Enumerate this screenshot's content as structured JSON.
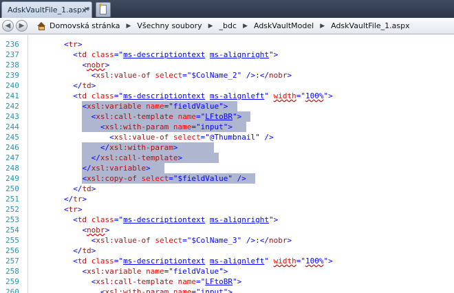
{
  "tabs": {
    "active_label": "AdskVaultFile_1.aspx",
    "modified_marker": "*",
    "close_glyph": "×"
  },
  "breadcrumb": {
    "back_icon": "back-arrow-icon",
    "forward_icon": "forward-arrow-icon",
    "items": [
      "Domovská stránka",
      "Všechny soubory",
      "_bdc",
      "AdskVaultModel",
      "AdskVaultFile_1.aspx"
    ]
  },
  "colors": {
    "selection": "#aeb7cf",
    "line_number": "#2b91af",
    "tag": "#0000ff",
    "element": "#a31515",
    "attribute": "#ff0000"
  },
  "editor": {
    "lines": [
      {
        "n": "236",
        "indent": 8,
        "tokens": [
          [
            "bl",
            "<"
          ],
          [
            "br",
            "tr"
          ],
          [
            "bl",
            ">"
          ]
        ]
      },
      {
        "n": "237",
        "indent": 10,
        "tokens": [
          [
            "bl",
            "<"
          ],
          [
            "br",
            "td"
          ],
          [
            "bl",
            " "
          ],
          [
            "rd",
            "class"
          ],
          [
            "bl",
            "=\""
          ],
          [
            "bl",
            "ms-descriptiontext",
            "ub"
          ],
          [
            "bl",
            " "
          ],
          [
            "bl",
            "ms-alignright",
            "ub"
          ],
          [
            "bl",
            "\">"
          ]
        ]
      },
      {
        "n": "238",
        "indent": 12,
        "tokens": [
          [
            "bl",
            "<"
          ],
          [
            "br",
            "nobr",
            "uw"
          ],
          [
            "bl",
            ">"
          ]
        ]
      },
      {
        "n": "239",
        "indent": 14,
        "tokens": [
          [
            "bl",
            "<"
          ],
          [
            "br",
            "xsl:value-of"
          ],
          [
            "bl",
            " "
          ],
          [
            "rd",
            "select"
          ],
          [
            "bl",
            "=\"$ColName_2\""
          ],
          [
            "bl",
            " />"
          ],
          [
            "bk",
            ":"
          ],
          [
            "bl",
            "</"
          ],
          [
            "br",
            "nobr"
          ],
          [
            "bl",
            ">"
          ]
        ]
      },
      {
        "n": "240",
        "indent": 10,
        "tokens": [
          [
            "bl",
            "</"
          ],
          [
            "br",
            "td"
          ],
          [
            "bl",
            ">"
          ]
        ]
      },
      {
        "n": "241",
        "indent": 10,
        "tokens": [
          [
            "bl",
            "<"
          ],
          [
            "br",
            "td"
          ],
          [
            "bl",
            " "
          ],
          [
            "rd",
            "class"
          ],
          [
            "bl",
            "=\""
          ],
          [
            "bl",
            "ms-descriptiontext",
            "ub"
          ],
          [
            "bl",
            " "
          ],
          [
            "bl",
            "ms-alignleft",
            "ub"
          ],
          [
            "bl",
            "\" "
          ],
          [
            "rd",
            "width",
            "uw"
          ],
          [
            "bl",
            "=\""
          ],
          [
            "bl",
            "100%",
            "uw"
          ],
          [
            "bl",
            "\">"
          ]
        ]
      },
      {
        "n": "242",
        "indent": 12,
        "sel": [
          12,
          46
        ],
        "tokens": [
          [
            "bl",
            "<"
          ],
          [
            "br",
            "xsl:variable"
          ],
          [
            "bl",
            " "
          ],
          [
            "rd",
            "name"
          ],
          [
            "bl",
            "=\"fieldValue\""
          ],
          [
            "bl",
            ">"
          ]
        ]
      },
      {
        "n": "243",
        "indent": 14,
        "sel": [
          12,
          49
        ],
        "tokens": [
          [
            "bl",
            "<"
          ],
          [
            "br",
            "xsl:call-template"
          ],
          [
            "bl",
            " "
          ],
          [
            "rd",
            "name"
          ],
          [
            "bl",
            "=\""
          ],
          [
            "bl",
            "LFtoBR",
            "ub"
          ],
          [
            "bl",
            "\">"
          ]
        ]
      },
      {
        "n": "244",
        "indent": 16,
        "sel": [
          12,
          48
        ],
        "tokens": [
          [
            "bl",
            "<"
          ],
          [
            "br",
            "xsl:with-param"
          ],
          [
            "bl",
            " "
          ],
          [
            "rd",
            "name"
          ],
          [
            "bl",
            "=\"input\""
          ],
          [
            "bl",
            ">"
          ]
        ]
      },
      {
        "n": "245",
        "indent": 18,
        "tokens": [
          [
            "bl",
            "<"
          ],
          [
            "br",
            "xsl:value-of"
          ],
          [
            "bl",
            " "
          ],
          [
            "rd",
            "select"
          ],
          [
            "bl",
            "=\"@Thumbnail\""
          ],
          [
            "bl",
            " />"
          ]
        ]
      },
      {
        "n": "246",
        "indent": 16,
        "sel": [
          12,
          41
        ],
        "tokens": [
          [
            "bl",
            "</"
          ],
          [
            "br",
            "xsl:with-param"
          ],
          [
            "bl",
            ">"
          ]
        ]
      },
      {
        "n": "247",
        "indent": 14,
        "sel": [
          12,
          42
        ],
        "tokens": [
          [
            "bl",
            "</"
          ],
          [
            "br",
            "xsl:call-template"
          ],
          [
            "bl",
            ">"
          ]
        ]
      },
      {
        "n": "248",
        "indent": 12,
        "sel": [
          12,
          30
        ],
        "tokens": [
          [
            "bl",
            "</"
          ],
          [
            "br",
            "xsl:variable"
          ],
          [
            "bl",
            ">"
          ]
        ]
      },
      {
        "n": "249",
        "indent": 12,
        "sel": [
          12,
          50
        ],
        "tokens": [
          [
            "bl",
            "<"
          ],
          [
            "br",
            "xsl:copy-of"
          ],
          [
            "bl",
            " "
          ],
          [
            "rd",
            "select"
          ],
          [
            "bl",
            "=\"$fieldValue\""
          ],
          [
            "bl",
            " />"
          ]
        ]
      },
      {
        "n": "250",
        "indent": 10,
        "tokens": [
          [
            "bl",
            "</"
          ],
          [
            "br",
            "td"
          ],
          [
            "bl",
            ">"
          ]
        ]
      },
      {
        "n": "251",
        "indent": 8,
        "tokens": [
          [
            "bl",
            "</"
          ],
          [
            "br",
            "tr"
          ],
          [
            "bl",
            ">"
          ]
        ]
      },
      {
        "n": "252",
        "indent": 8,
        "tokens": [
          [
            "bl",
            "<"
          ],
          [
            "br",
            "tr"
          ],
          [
            "bl",
            ">"
          ]
        ]
      },
      {
        "n": "253",
        "indent": 10,
        "tokens": [
          [
            "bl",
            "<"
          ],
          [
            "br",
            "td"
          ],
          [
            "bl",
            " "
          ],
          [
            "rd",
            "class"
          ],
          [
            "bl",
            "=\""
          ],
          [
            "bl",
            "ms-descriptiontext",
            "ub"
          ],
          [
            "bl",
            " "
          ],
          [
            "bl",
            "ms-alignright",
            "ub"
          ],
          [
            "bl",
            "\">"
          ]
        ]
      },
      {
        "n": "254",
        "indent": 12,
        "tokens": [
          [
            "bl",
            "<"
          ],
          [
            "br",
            "nobr",
            "uw"
          ],
          [
            "bl",
            ">"
          ]
        ]
      },
      {
        "n": "255",
        "indent": 14,
        "tokens": [
          [
            "bl",
            "<"
          ],
          [
            "br",
            "xsl:value-of"
          ],
          [
            "bl",
            " "
          ],
          [
            "rd",
            "select"
          ],
          [
            "bl",
            "=\"$ColName_3\""
          ],
          [
            "bl",
            " />"
          ],
          [
            "bk",
            ":"
          ],
          [
            "bl",
            "</"
          ],
          [
            "br",
            "nobr"
          ],
          [
            "bl",
            ">"
          ]
        ]
      },
      {
        "n": "256",
        "indent": 10,
        "tokens": [
          [
            "bl",
            "</"
          ],
          [
            "br",
            "td"
          ],
          [
            "bl",
            ">"
          ]
        ]
      },
      {
        "n": "257",
        "indent": 10,
        "tokens": [
          [
            "bl",
            "<"
          ],
          [
            "br",
            "td"
          ],
          [
            "bl",
            " "
          ],
          [
            "rd",
            "class"
          ],
          [
            "bl",
            "=\""
          ],
          [
            "bl",
            "ms-descriptiontext",
            "ub"
          ],
          [
            "bl",
            " "
          ],
          [
            "bl",
            "ms-alignleft",
            "ub"
          ],
          [
            "bl",
            "\" "
          ],
          [
            "rd",
            "width",
            "uw"
          ],
          [
            "bl",
            "=\""
          ],
          [
            "bl",
            "100%",
            "uw"
          ],
          [
            "bl",
            "\">"
          ]
        ]
      },
      {
        "n": "258",
        "indent": 12,
        "tokens": [
          [
            "bl",
            "<"
          ],
          [
            "br",
            "xsl:variable"
          ],
          [
            "bl",
            " "
          ],
          [
            "rd",
            "name"
          ],
          [
            "bl",
            "=\"fieldValue\""
          ],
          [
            "bl",
            ">"
          ]
        ]
      },
      {
        "n": "259",
        "indent": 14,
        "tokens": [
          [
            "bl",
            "<"
          ],
          [
            "br",
            "xsl:call-template"
          ],
          [
            "bl",
            " "
          ],
          [
            "rd",
            "name"
          ],
          [
            "bl",
            "=\""
          ],
          [
            "bl",
            "LFtoBR",
            "ub"
          ],
          [
            "bl",
            "\">"
          ]
        ]
      },
      {
        "n": "260",
        "indent": 16,
        "tokens": [
          [
            "bl",
            "<"
          ],
          [
            "br",
            "xsl:with-param"
          ],
          [
            "bl",
            " "
          ],
          [
            "rd",
            "name"
          ],
          [
            "bl",
            "=\"input\""
          ],
          [
            "bl",
            ">"
          ]
        ]
      }
    ]
  }
}
